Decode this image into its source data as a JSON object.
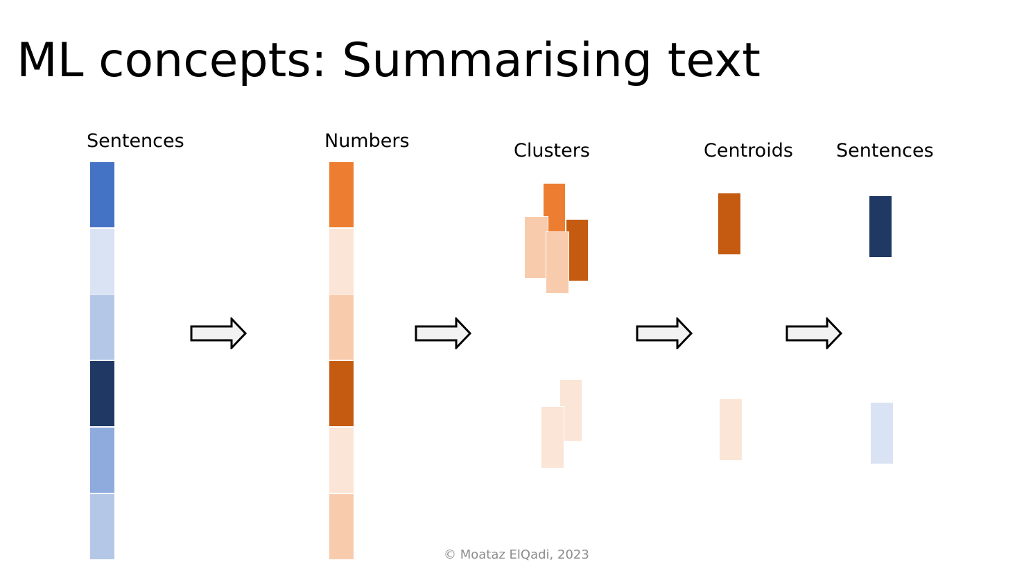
{
  "title": "ML concepts: Summarising text",
  "stages": {
    "sentences_in": "Sentences",
    "numbers": "Numbers",
    "clusters": "Clusters",
    "centroids": "Centroids",
    "sentences_out": "Sentences"
  },
  "sentence_colors": [
    "#4472C4",
    "#DAE3F3",
    "#B4C7E7",
    "#203864",
    "#8FAADC",
    "#B4C7E7"
  ],
  "number_colors": [
    "#ED7D31",
    "#FBE5D6",
    "#F8CBAD",
    "#C55A11",
    "#FBE5D6",
    "#F8CBAD"
  ],
  "footer": "© Moataz ElQadi, 2023"
}
